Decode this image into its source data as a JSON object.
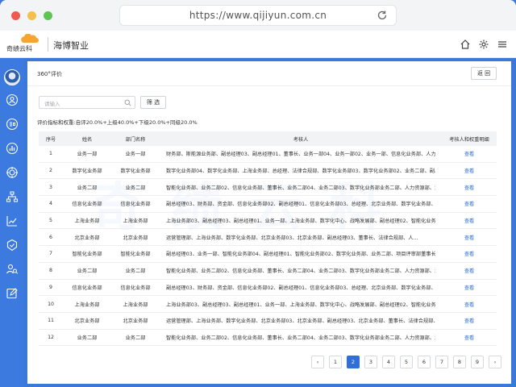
{
  "browser": {
    "url": "https://www.qijiyun.com.cn"
  },
  "header": {
    "logo_text": "奇绩云科",
    "brand": "海博智业"
  },
  "page": {
    "title": "360°评价",
    "back_label": "返 回"
  },
  "search": {
    "placeholder": "请输入",
    "filter_label": "筛 选"
  },
  "weights_text": "评价指标和权重:自评20.0%+上级40.0%+下级20.0%+同级20.0%",
  "table": {
    "headers": {
      "no": "序号",
      "name": "姓名",
      "dept": "部门名称",
      "assessors": "考核人",
      "op": "考核人和权重明细"
    },
    "rows": [
      {
        "no": "1",
        "name": "业务一部",
        "dept": "业务一部",
        "assessors": "财务部、斯能源业务部、副总经理03、副总经理01、董事长、业务一部04、业务一部02、业务一部、信息化业务部、人力资...",
        "op": "查看"
      },
      {
        "no": "2",
        "name": "数字化业务部",
        "dept": "数字化业务部",
        "assessors": "数字化业务部04、数字化业务部、上海业务部、总经理、法律合规部、数字化业务部03、数字化业务部02、业务二部、副总经...",
        "op": "查看"
      },
      {
        "no": "3",
        "name": "业务二部",
        "dept": "业务二部",
        "assessors": "智能化业务部、业务二部02、信息化业务部、董事长、业务二部04、业务二部03、数字化业务部业务二部、人力资源部、法律...",
        "op": "查看"
      },
      {
        "no": "4",
        "name": "信息化业务部",
        "dept": "信息化业务部",
        "assessors": "副总经理03、财务部、资金部、信息化业务部02、副总经理01、信息化业务部03、总经理、北京业务部、数字化业务部、信...",
        "op": "查看"
      },
      {
        "no": "5",
        "name": "上海业务部",
        "dept": "上海业务部",
        "assessors": "上海业务部03、副总经理03、副总经理01、业务一部、上海业务部、数字化中心、战略发展部、副总经理02、智能化业务部、...",
        "op": "查看"
      },
      {
        "no": "6",
        "name": "北京业务部",
        "dept": "北京业务部",
        "assessors": "运营管理部、上海业务部、数字化业务部、北京业务部03、北京业务部、副总经理03、董事长、法律合规部、人...",
        "op": "查看"
      },
      {
        "no": "7",
        "name": "智能化业务部",
        "dept": "智能化业务部",
        "assessors": "副总经理03、业务一部、智能化业务部04、副总经理01、智能化业务部02、数字化业务部、业务二部、项目评审部董事长、上...",
        "op": "查看"
      },
      {
        "no": "8",
        "name": "业务二部",
        "dept": "业务二部",
        "assessors": "智能化业务部、业务二部02、信息化业务部、董事长、业务二部04、业务二部03、数字化业务部业务二部、人力资源部、法律...",
        "op": "查看"
      },
      {
        "no": "9",
        "name": "信息化业务部",
        "dept": "信息化业务部",
        "assessors": "副总经理03、财务部、资金部、信息化业务部02、副总经理01、信息化业务部03、总经理、北京业务部、数字化业务部、信...",
        "op": "查看"
      },
      {
        "no": "10",
        "name": "上海业务部",
        "dept": "上海业务部",
        "assessors": "上海业务部03、副总经理03、副总经理01、业务一部、上海业务部、数字化中心、战略发展部、副总经理02、智能化业务部、...",
        "op": "查看"
      },
      {
        "no": "11",
        "name": "北京业务部",
        "dept": "北京业务部",
        "assessors": "运营管理部、上海业务部、数字化业务部、北京业务部03、北京业务部、副总经理03、北京业务部、董事长、法律合规部、人...",
        "op": "查看"
      },
      {
        "no": "12",
        "name": "业务二部",
        "dept": "业务二部",
        "assessors": "智能化业务部、业务二部02、信息化业务部、董事长、业务二部04、业务二部03、数字化业务部业务二部、人力资源部、法律...",
        "op": "查看"
      }
    ]
  },
  "pagination": {
    "prev": "‹",
    "next": "›",
    "pages": [
      "1",
      "2",
      "3",
      "4",
      "5",
      "6",
      "7",
      "8",
      "9"
    ],
    "current": "2"
  },
  "colors": {
    "primary": "#2f6fd6",
    "sidebar": "#3d7ae0"
  }
}
